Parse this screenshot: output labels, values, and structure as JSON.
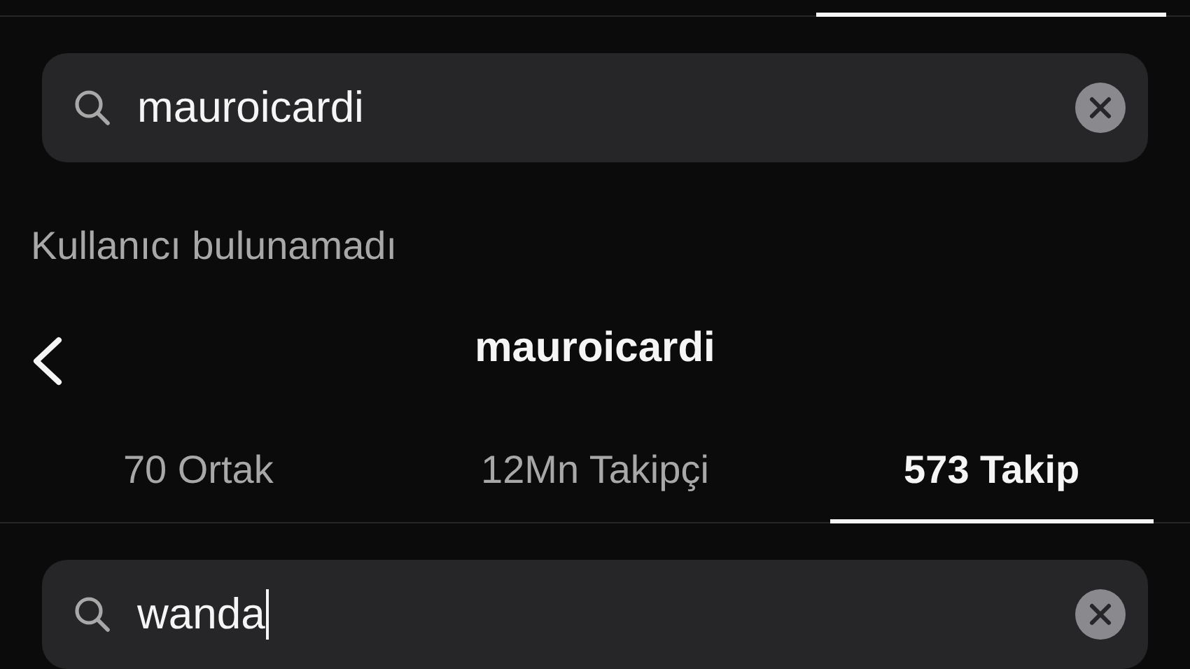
{
  "search": {
    "value": "mauroicardi"
  },
  "message": "Kullanıcı bulunamadı",
  "header": {
    "title": "mauroicardi"
  },
  "tabs": [
    {
      "label": "70 Ortak",
      "selected": false
    },
    {
      "label": "12Mn Takipçi",
      "selected": false
    },
    {
      "label": "573 Takip",
      "selected": true
    }
  ],
  "list_search": {
    "value": "wanda",
    "focused": true
  }
}
